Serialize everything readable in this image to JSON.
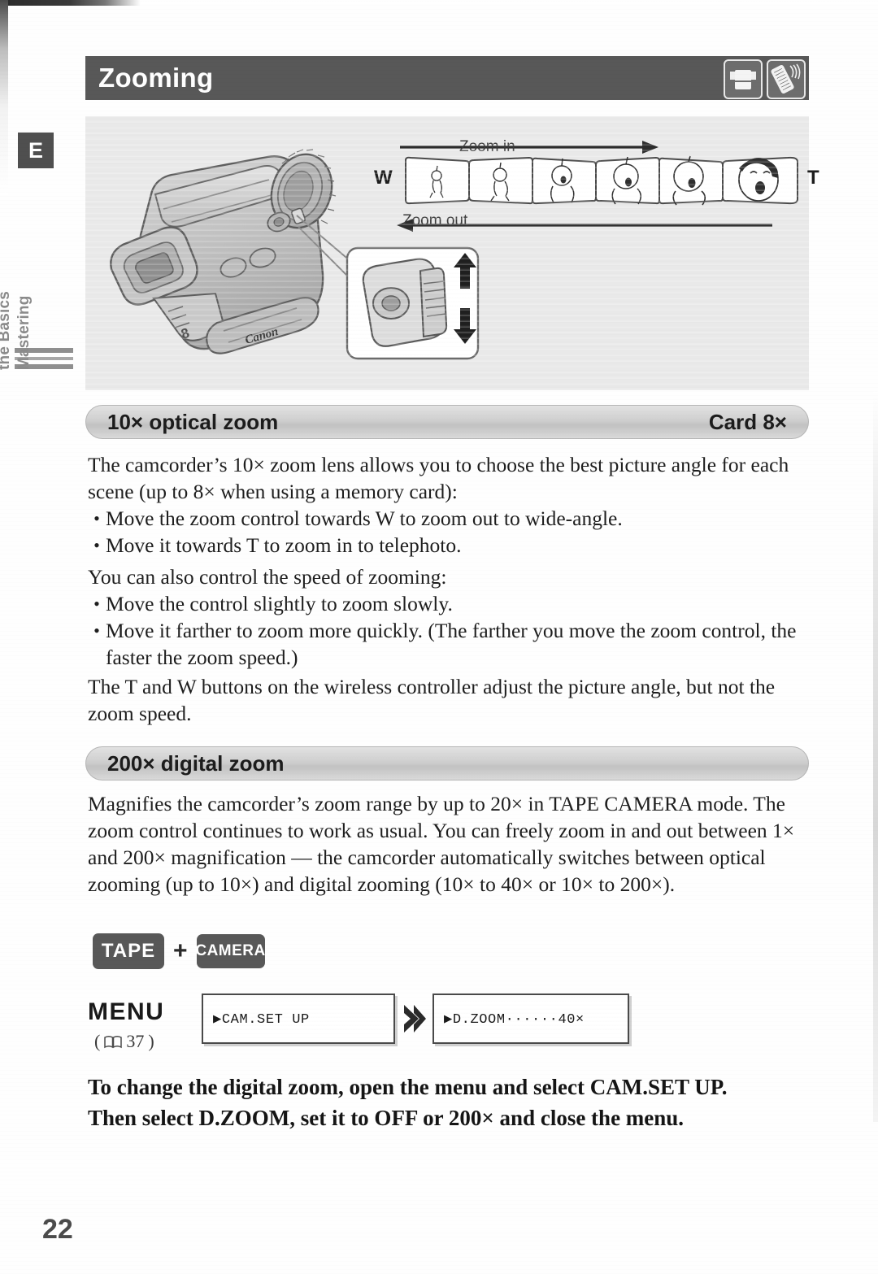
{
  "page": {
    "number": "22",
    "chapter_letter": "E",
    "sidebar_label_line1": "Mastering",
    "sidebar_label_line2": "the Basics"
  },
  "header": {
    "title": "Zooming",
    "mode_icons": [
      {
        "name": "camcorder-tape-icon"
      },
      {
        "name": "wireless-controller-icon"
      }
    ]
  },
  "illustration": {
    "zoom_in_label": "Zoom in",
    "zoom_out_label": "Zoom out",
    "wide_label": "W",
    "tele_label": "T",
    "brand_text": "Canon",
    "frame_count": 6,
    "caption_alt": "Camcorder with zoom control rocker callout and six frames showing progressive zoom from wide-angle to telephoto"
  },
  "optical_section": {
    "heading": "10× optical zoom",
    "badge_right": "Card 8×",
    "intro": "The camcorder’s 10× zoom lens allows you to choose the best picture angle for each scene (up to 8× when using a memory card):",
    "bullets": [
      "Move the zoom control towards W to zoom out to wide-angle.",
      "Move it towards T to zoom in to telephoto."
    ],
    "speed_intro": "You can also control the speed of zooming:",
    "speed_bullets": [
      "Move the control slightly to zoom slowly.",
      "Move it farther to zoom more quickly. (The farther you move the zoom control, the faster the zoom speed.)"
    ],
    "controller_note": "The T and W buttons on the wireless controller adjust the picture angle, but not the zoom speed."
  },
  "digital_section": {
    "heading": "200× digital zoom",
    "body": "Magnifies the camcorder’s zoom range by up to 20× in TAPE CAMERA mode. The zoom control continues to work as usual. You can freely zoom in and out between 1× and 200× magnification — the camcorder automatically switches between optical zooming (up to 10×) and digital zooming (10× to 40× or 10× to 200×)."
  },
  "mode_badges": {
    "tape": "TAPE",
    "plus": "+",
    "camera": "CAMERA"
  },
  "menu_flow": {
    "label": "MENU",
    "page_ref_open": "(",
    "page_ref_number": "37",
    "page_ref_close": ")",
    "screen_1": "▶CAM.SET UP",
    "screen_2": "▶D.ZOOM······40×"
  },
  "instruction": {
    "line1": "To change the digital zoom, open the menu and select CAM.SET UP.",
    "line2": "Then select D.ZOOM, set it to OFF or 200× and close the menu."
  }
}
